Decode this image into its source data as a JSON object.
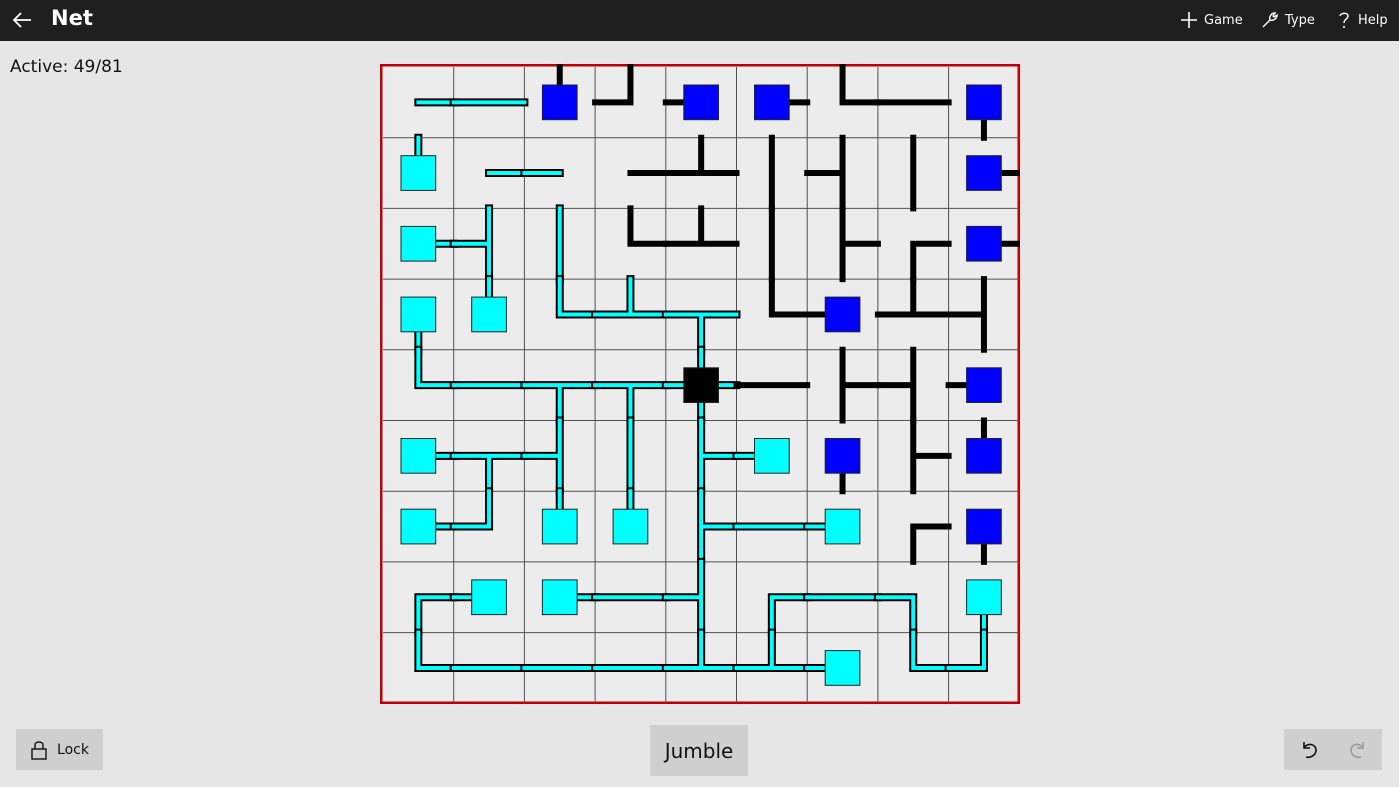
{
  "app": {
    "title": "Net"
  },
  "commands": [
    {
      "label": "Game",
      "icon": "plus-icon"
    },
    {
      "label": "Type",
      "icon": "wrench-icon"
    },
    {
      "label": "Help",
      "icon": "question-icon"
    }
  ],
  "status": {
    "text": "Active: 49/81"
  },
  "buttons": {
    "lock": "Lock",
    "jumble": "Jumble",
    "undo_icon": "undo-icon",
    "redo_icon": "redo-icon"
  },
  "colors": {
    "active": "#00ffff",
    "inactive": "#0000ff",
    "server": "#000000",
    "wire": "#000000",
    "border": "#c00000",
    "grid": "#505050",
    "cell_bg": "#ececec"
  },
  "board": {
    "rows": 9,
    "cols": 9,
    "cells": [
      {
        "r": 0,
        "c": 0,
        "t": "wire",
        "s": "E",
        "a": 1
      },
      {
        "r": 0,
        "c": 1,
        "t": "wire",
        "s": "EW",
        "a": 1
      },
      {
        "r": 0,
        "c": 2,
        "t": "node",
        "s": "N",
        "a": 0
      },
      {
        "r": 0,
        "c": 3,
        "t": "wire",
        "s": "NW",
        "a": 0
      },
      {
        "r": 0,
        "c": 4,
        "t": "node",
        "s": "W",
        "a": 0
      },
      {
        "r": 0,
        "c": 5,
        "t": "node",
        "s": "E",
        "a": 0
      },
      {
        "r": 0,
        "c": 6,
        "t": "wire",
        "s": "NE",
        "a": 0
      },
      {
        "r": 0,
        "c": 7,
        "t": "wire",
        "s": "EW",
        "a": 0
      },
      {
        "r": 0,
        "c": 8,
        "t": "node",
        "s": "S",
        "a": 0
      },
      {
        "r": 1,
        "c": 0,
        "t": "node",
        "s": "N",
        "a": 1
      },
      {
        "r": 1,
        "c": 1,
        "t": "wire",
        "s": "E",
        "a": 1
      },
      {
        "r": 1,
        "c": 2,
        "t": "wire",
        "s": "W",
        "a": 1
      },
      {
        "r": 1,
        "c": 3,
        "t": "wire",
        "s": "E",
        "a": 0
      },
      {
        "r": 1,
        "c": 4,
        "t": "wire",
        "s": "NEW",
        "a": 0
      },
      {
        "r": 1,
        "c": 5,
        "t": "wire",
        "s": "NS",
        "a": 0
      },
      {
        "r": 1,
        "c": 6,
        "t": "wire",
        "s": "NSW",
        "a": 0
      },
      {
        "r": 1,
        "c": 7,
        "t": "wire",
        "s": "NS",
        "a": 0
      },
      {
        "r": 1,
        "c": 8,
        "t": "node",
        "s": "E",
        "a": 0
      },
      {
        "r": 2,
        "c": 0,
        "t": "node",
        "s": "E",
        "a": 1
      },
      {
        "r": 2,
        "c": 1,
        "t": "wire",
        "s": "NSW",
        "a": 1
      },
      {
        "r": 2,
        "c": 2,
        "t": "wire",
        "s": "NS",
        "a": 1
      },
      {
        "r": 2,
        "c": 3,
        "t": "wire",
        "s": "NE",
        "a": 0
      },
      {
        "r": 2,
        "c": 4,
        "t": "wire",
        "s": "NEW",
        "a": 0
      },
      {
        "r": 2,
        "c": 5,
        "t": "wire",
        "s": "NS",
        "a": 0
      },
      {
        "r": 2,
        "c": 6,
        "t": "wire",
        "s": "NSE",
        "a": 0
      },
      {
        "r": 2,
        "c": 7,
        "t": "wire",
        "s": "SE",
        "a": 0
      },
      {
        "r": 2,
        "c": 8,
        "t": "node",
        "s": "E",
        "a": 0
      },
      {
        "r": 3,
        "c": 0,
        "t": "node",
        "s": "S",
        "a": 1
      },
      {
        "r": 3,
        "c": 1,
        "t": "node",
        "s": "N",
        "a": 1
      },
      {
        "r": 3,
        "c": 2,
        "t": "wire",
        "s": "NE",
        "a": 1
      },
      {
        "r": 3,
        "c": 3,
        "t": "wire",
        "s": "NEW",
        "a": 1
      },
      {
        "r": 3,
        "c": 4,
        "t": "wire",
        "s": "ESW",
        "a": 1
      },
      {
        "r": 3,
        "c": 5,
        "t": "wire",
        "s": "NE",
        "a": 0
      },
      {
        "r": 3,
        "c": 6,
        "t": "node",
        "s": "W",
        "a": 0
      },
      {
        "r": 3,
        "c": 7,
        "t": "wire",
        "s": "NEW",
        "a": 0
      },
      {
        "r": 3,
        "c": 8,
        "t": "wire",
        "s": "NSW",
        "a": 0
      },
      {
        "r": 4,
        "c": 0,
        "t": "wire",
        "s": "NE",
        "a": 1
      },
      {
        "r": 4,
        "c": 1,
        "t": "wire",
        "s": "EW",
        "a": 1
      },
      {
        "r": 4,
        "c": 2,
        "t": "wire",
        "s": "ESW",
        "a": 1
      },
      {
        "r": 4,
        "c": 3,
        "t": "wire",
        "s": "ESW",
        "a": 1
      },
      {
        "r": 4,
        "c": 4,
        "t": "server",
        "s": "NSEW",
        "a": 1
      },
      {
        "r": 4,
        "c": 5,
        "t": "wire",
        "s": "EW",
        "a": 0
      },
      {
        "r": 4,
        "c": 6,
        "t": "wire",
        "s": "NSE",
        "a": 0
      },
      {
        "r": 4,
        "c": 7,
        "t": "wire",
        "s": "NSW",
        "a": 0
      },
      {
        "r": 4,
        "c": 8,
        "t": "node",
        "s": "W",
        "a": 0
      },
      {
        "r": 5,
        "c": 0,
        "t": "node",
        "s": "E",
        "a": 1
      },
      {
        "r": 5,
        "c": 1,
        "t": "wire",
        "s": "ESW",
        "a": 1
      },
      {
        "r": 5,
        "c": 2,
        "t": "wire",
        "s": "NSW",
        "a": 1
      },
      {
        "r": 5,
        "c": 3,
        "t": "wire",
        "s": "NS",
        "a": 1
      },
      {
        "r": 5,
        "c": 4,
        "t": "wire",
        "s": "NSE",
        "a": 1
      },
      {
        "r": 5,
        "c": 5,
        "t": "node",
        "s": "W",
        "a": 1
      },
      {
        "r": 5,
        "c": 6,
        "t": "node",
        "s": "S",
        "a": 0
      },
      {
        "r": 5,
        "c": 7,
        "t": "wire",
        "s": "NSE",
        "a": 0
      },
      {
        "r": 5,
        "c": 8,
        "t": "node",
        "s": "N",
        "a": 0
      },
      {
        "r": 6,
        "c": 0,
        "t": "node",
        "s": "E",
        "a": 1
      },
      {
        "r": 6,
        "c": 1,
        "t": "wire",
        "s": "NW",
        "a": 1
      },
      {
        "r": 6,
        "c": 2,
        "t": "node",
        "s": "N",
        "a": 1
      },
      {
        "r": 6,
        "c": 3,
        "t": "node",
        "s": "N",
        "a": 1
      },
      {
        "r": 6,
        "c": 4,
        "t": "wire",
        "s": "NSE",
        "a": 1
      },
      {
        "r": 6,
        "c": 5,
        "t": "wire",
        "s": "EW",
        "a": 1
      },
      {
        "r": 6,
        "c": 6,
        "t": "node",
        "s": "W",
        "a": 1
      },
      {
        "r": 6,
        "c": 7,
        "t": "wire",
        "s": "SE",
        "a": 0
      },
      {
        "r": 6,
        "c": 8,
        "t": "node",
        "s": "S",
        "a": 0
      },
      {
        "r": 7,
        "c": 0,
        "t": "wire",
        "s": "SE",
        "a": 1
      },
      {
        "r": 7,
        "c": 1,
        "t": "node",
        "s": "W",
        "a": 1
      },
      {
        "r": 7,
        "c": 2,
        "t": "node",
        "s": "E",
        "a": 1
      },
      {
        "r": 7,
        "c": 3,
        "t": "wire",
        "s": "EW",
        "a": 1
      },
      {
        "r": 7,
        "c": 4,
        "t": "wire",
        "s": "NSW",
        "a": 1
      },
      {
        "r": 7,
        "c": 5,
        "t": "wire",
        "s": "SE",
        "a": 1
      },
      {
        "r": 7,
        "c": 6,
        "t": "wire",
        "s": "EW",
        "a": 1
      },
      {
        "r": 7,
        "c": 7,
        "t": "wire",
        "s": "SW",
        "a": 1
      },
      {
        "r": 7,
        "c": 8,
        "t": "node",
        "s": "S",
        "a": 1
      },
      {
        "r": 8,
        "c": 0,
        "t": "wire",
        "s": "NE",
        "a": 1
      },
      {
        "r": 8,
        "c": 1,
        "t": "wire",
        "s": "EW",
        "a": 1
      },
      {
        "r": 8,
        "c": 2,
        "t": "wire",
        "s": "EW",
        "a": 1
      },
      {
        "r": 8,
        "c": 3,
        "t": "wire",
        "s": "EW",
        "a": 1
      },
      {
        "r": 8,
        "c": 4,
        "t": "wire",
        "s": "NEW",
        "a": 1
      },
      {
        "r": 8,
        "c": 5,
        "t": "wire",
        "s": "NEW",
        "a": 1
      },
      {
        "r": 8,
        "c": 6,
        "t": "node",
        "s": "W",
        "a": 1
      },
      {
        "r": 8,
        "c": 7,
        "t": "wire",
        "s": "NE",
        "a": 1
      },
      {
        "r": 8,
        "c": 8,
        "t": "wire",
        "s": "NW",
        "a": 1
      }
    ]
  }
}
